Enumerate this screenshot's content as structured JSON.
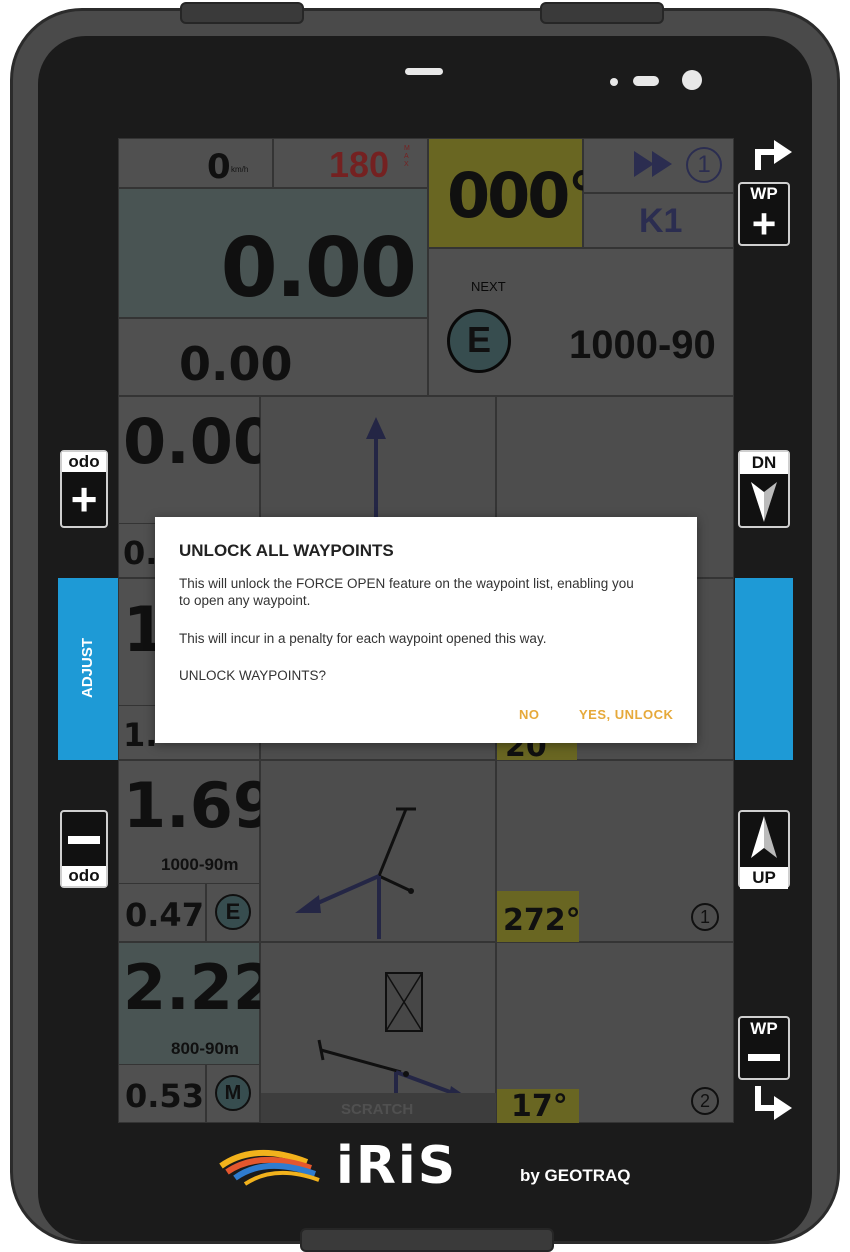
{
  "status_bar": {},
  "top_row": {
    "speed": "0",
    "speed_unit": "km/h",
    "max_speed": "180",
    "max_label": "MAX",
    "heading": "000°",
    "next_label": "NEXT",
    "next_badge": "E",
    "next_value": "1000-90",
    "waypoint_number": "1",
    "waypoint_code": "K1",
    "odometer": "0.00",
    "partial": "0.00"
  },
  "rows": [
    {
      "distance": "0.00",
      "small_left": "0.",
      "angle": "",
      "number": ""
    },
    {
      "distance": "1",
      "small_left": "1.",
      "angle": "20",
      "number": ""
    },
    {
      "distance": "1.69",
      "label": "1000-90m",
      "small_left": "0.47",
      "badge": "E",
      "angle": "272°",
      "number": "1"
    },
    {
      "distance": "2.22",
      "label": "800-90m",
      "small_left": "0.53",
      "badge": "M",
      "angle": "17°",
      "number": "2"
    }
  ],
  "scratch_label": "SCRATCH",
  "side": {
    "left_odo_plus_label": "odo",
    "left_adjust_label": "ADJUST",
    "left_odo_minus_label": "odo",
    "right_wp_plus_label": "WP",
    "right_dn_label": "DN",
    "right_up_label": "UP",
    "right_wp_minus_label": "WP"
  },
  "dialog": {
    "title": "UNLOCK ALL WAYPOINTS",
    "line1": "This will unlock the FORCE OPEN feature on the waypoint list, enabling you to open any waypoint.",
    "line2": "This will incur in a penalty for each waypoint opened this way.",
    "line3": "UNLOCK WAYPOINTS?",
    "no_button": "NO",
    "yes_button": "YES, UNLOCK"
  },
  "brand": {
    "logo_text": "iRiS",
    "by_text": "by GEOTRAQ"
  },
  "colors": {
    "accent_blue": "#1e9ad6",
    "dialog_button": "#e6a93a",
    "max_red": "#c8393a",
    "waypoint_blue": "#4a4f8a",
    "yellow_cell": "#b6b03b"
  }
}
